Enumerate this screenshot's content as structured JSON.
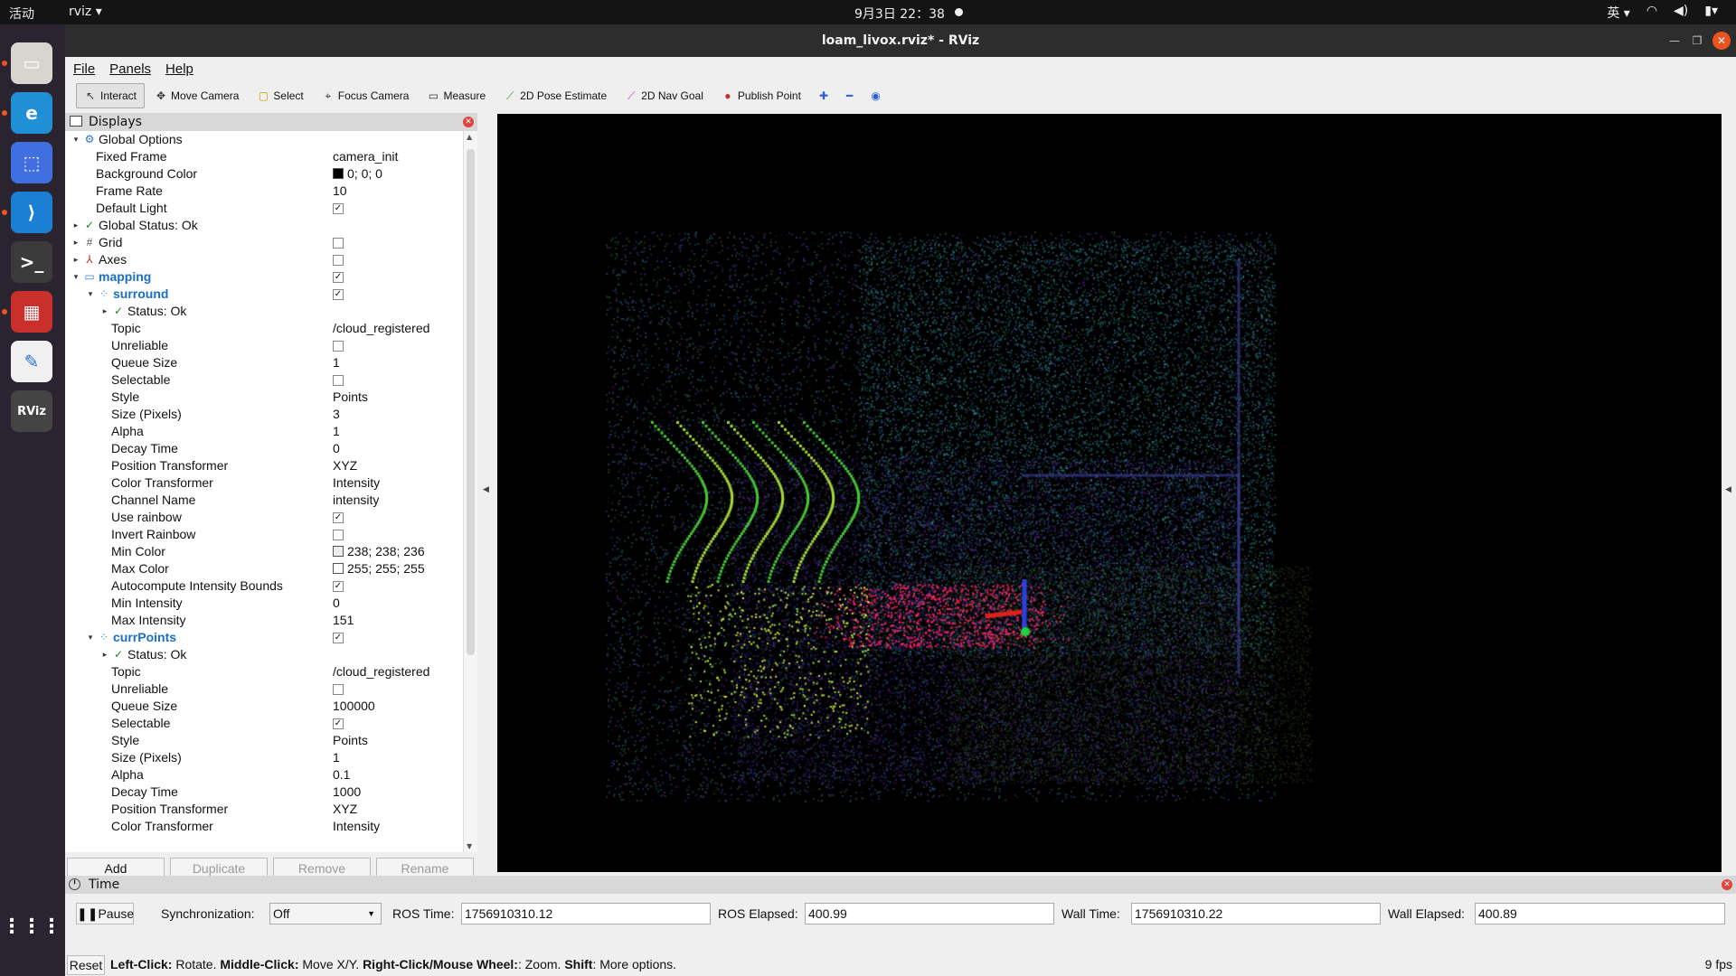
{
  "topbar": {
    "activities": "活动",
    "app": "rviz ▾",
    "clock": "9月3日  22：38",
    "ime": "英 ▾"
  },
  "window": {
    "title": "loam_livox.rviz* - RViz"
  },
  "menu": [
    "File",
    "Panels",
    "Help"
  ],
  "toolbar": [
    {
      "label": "Interact",
      "icon": "interact-icon",
      "active": true
    },
    {
      "label": "Move Camera",
      "icon": "move-camera-icon"
    },
    {
      "label": "Select",
      "icon": "select-icon"
    },
    {
      "label": "Focus Camera",
      "icon": "focus-camera-icon"
    },
    {
      "label": "Measure",
      "icon": "measure-icon"
    },
    {
      "label": "2D Pose Estimate",
      "icon": "pose-estimate-icon"
    },
    {
      "label": "2D Nav Goal",
      "icon": "nav-goal-icon"
    },
    {
      "label": "Publish Point",
      "icon": "publish-point-icon"
    }
  ],
  "displays": {
    "header": "Displays",
    "rows": [
      {
        "d": 0,
        "arrow": "▾",
        "icon": "⚙",
        "name": "Global Options"
      },
      {
        "d": 1,
        "name": "Fixed Frame",
        "val": "camera_init"
      },
      {
        "d": 1,
        "name": "Background Color",
        "val": "0; 0; 0",
        "swatch": "#000000"
      },
      {
        "d": 1,
        "name": "Frame Rate",
        "val": "10"
      },
      {
        "d": 1,
        "name": "Default Light",
        "check": true
      },
      {
        "d": 0,
        "arrow": "▸",
        "icon": "✓",
        "name": "Global Status: Ok"
      },
      {
        "d": 0,
        "arrow": "▸",
        "icon": "#",
        "name": "Grid",
        "check": false
      },
      {
        "d": 0,
        "arrow": "▸",
        "icon": "⅄",
        "name": "Axes",
        "check": false
      },
      {
        "d": 0,
        "arrow": "▾",
        "icon": "▭",
        "name": "mapping",
        "check": true,
        "hl": true
      },
      {
        "d": 1,
        "arrow": "▾",
        "icon": "⁘",
        "name": "surround",
        "check": true,
        "hl": true
      },
      {
        "d": 2,
        "arrow": "▸",
        "icon": "✓",
        "name": "Status: Ok"
      },
      {
        "d": 2,
        "name": "Topic",
        "val": "/cloud_registered"
      },
      {
        "d": 2,
        "name": "Unreliable",
        "check": false
      },
      {
        "d": 2,
        "name": "Queue Size",
        "val": "1"
      },
      {
        "d": 2,
        "name": "Selectable",
        "check": false
      },
      {
        "d": 2,
        "name": "Style",
        "val": "Points"
      },
      {
        "d": 2,
        "name": "Size (Pixels)",
        "val": "3"
      },
      {
        "d": 2,
        "name": "Alpha",
        "val": "1"
      },
      {
        "d": 2,
        "name": "Decay Time",
        "val": "0"
      },
      {
        "d": 2,
        "name": "Position Transformer",
        "val": "XYZ"
      },
      {
        "d": 2,
        "name": "Color Transformer",
        "val": "Intensity"
      },
      {
        "d": 2,
        "name": "Channel Name",
        "val": "intensity"
      },
      {
        "d": 2,
        "name": "Use rainbow",
        "check": true
      },
      {
        "d": 2,
        "name": "Invert Rainbow",
        "check": false
      },
      {
        "d": 2,
        "name": "Min Color",
        "val": "238; 238; 236",
        "swatch": "#eeeeec"
      },
      {
        "d": 2,
        "name": "Max Color",
        "val": "255; 255; 255",
        "swatch": "#ffffff"
      },
      {
        "d": 2,
        "name": "Autocompute Intensity Bounds",
        "check": true
      },
      {
        "d": 2,
        "name": "Min Intensity",
        "val": "0"
      },
      {
        "d": 2,
        "name": "Max Intensity",
        "val": "151"
      },
      {
        "d": 1,
        "arrow": "▾",
        "icon": "⁘",
        "name": "currPoints",
        "check": true,
        "hl": true
      },
      {
        "d": 2,
        "arrow": "▸",
        "icon": "✓",
        "name": "Status: Ok"
      },
      {
        "d": 2,
        "name": "Topic",
        "val": "/cloud_registered"
      },
      {
        "d": 2,
        "name": "Unreliable",
        "check": false
      },
      {
        "d": 2,
        "name": "Queue Size",
        "val": "100000"
      },
      {
        "d": 2,
        "name": "Selectable",
        "check": true
      },
      {
        "d": 2,
        "name": "Style",
        "val": "Points"
      },
      {
        "d": 2,
        "name": "Size (Pixels)",
        "val": "1"
      },
      {
        "d": 2,
        "name": "Alpha",
        "val": "0.1"
      },
      {
        "d": 2,
        "name": "Decay Time",
        "val": "1000"
      },
      {
        "d": 2,
        "name": "Position Transformer",
        "val": "XYZ"
      },
      {
        "d": 2,
        "name": "Color Transformer",
        "val": "Intensity"
      }
    ],
    "buttons": {
      "add": "Add",
      "duplicate": "Duplicate",
      "remove": "Remove",
      "rename": "Rename"
    }
  },
  "time": {
    "header": "Time",
    "pause": "Pause",
    "sync_label": "Synchronization:",
    "sync_value": "Off",
    "ros_time_label": "ROS Time:",
    "ros_time": "1756910310.12",
    "ros_elapsed_label": "ROS Elapsed:",
    "ros_elapsed": "400.99",
    "wall_time_label": "Wall Time:",
    "wall_time": "1756910310.22",
    "wall_elapsed_label": "Wall Elapsed:",
    "wall_elapsed": "400.89"
  },
  "status": {
    "reset": "Reset",
    "b1": "Left-Click:",
    "t1": " Rotate. ",
    "b2": "Middle-Click:",
    "t2": " Move X/Y. ",
    "b3": "Right-Click/Mouse Wheel:",
    "t3": ": Zoom. ",
    "b4": "Shift",
    "t4": ": More options.",
    "fps": "9 fps"
  },
  "dock": [
    {
      "name": "files-icon",
      "color": "#d8d4cf"
    },
    {
      "name": "edge-icon",
      "color": "#1f8fd6"
    },
    {
      "name": "screenshot-icon",
      "color": "#3f6fe0"
    },
    {
      "name": "vscode-icon",
      "color": "#1b7fd4"
    },
    {
      "name": "terminal-icon",
      "color": "#3b3b3b"
    },
    {
      "name": "workspace-icon",
      "color": "#c9302c"
    },
    {
      "name": "text-editor-icon",
      "color": "#f0f0f0"
    },
    {
      "name": "rviz-icon",
      "color": "#444"
    }
  ]
}
